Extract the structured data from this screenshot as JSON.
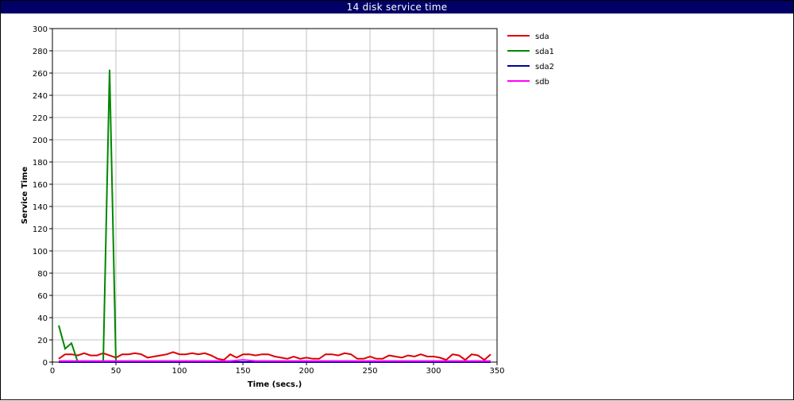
{
  "window": {
    "title": "14 disk service time"
  },
  "chart_data": {
    "type": "line",
    "title": "14 disk service time",
    "xlabel": "Time (secs.)",
    "ylabel": "Service Time",
    "xlim": [
      0,
      350
    ],
    "ylim": [
      0,
      300
    ],
    "xticks": [
      0,
      50,
      100,
      150,
      200,
      250,
      300,
      350
    ],
    "yticks": [
      0,
      20,
      40,
      60,
      80,
      100,
      120,
      140,
      160,
      180,
      200,
      220,
      240,
      260,
      280,
      300
    ],
    "grid": true,
    "legend_position": "right",
    "series": [
      {
        "name": "sda",
        "color": "#dd0000",
        "x": [
          5,
          10,
          15,
          20,
          25,
          30,
          35,
          40,
          45,
          50,
          55,
          60,
          65,
          70,
          75,
          80,
          85,
          90,
          95,
          100,
          105,
          110,
          115,
          120,
          125,
          130,
          135,
          140,
          145,
          150,
          155,
          160,
          165,
          170,
          175,
          180,
          185,
          190,
          195,
          200,
          205,
          210,
          215,
          220,
          225,
          230,
          235,
          240,
          245,
          250,
          255,
          260,
          265,
          270,
          275,
          280,
          285,
          290,
          295,
          300,
          305,
          310,
          315,
          320,
          325,
          330,
          335,
          340,
          345
        ],
        "y": [
          3,
          7,
          7,
          6,
          8,
          6,
          6,
          8,
          6,
          4,
          7,
          7,
          8,
          7,
          4,
          5,
          6,
          7,
          9,
          7,
          7,
          8,
          7,
          8,
          6,
          3,
          2,
          7,
          4,
          7,
          7,
          6,
          7,
          7,
          5,
          4,
          3,
          5,
          3,
          4,
          3,
          3,
          7,
          7,
          6,
          8,
          7,
          3,
          3,
          5,
          3,
          3,
          6,
          5,
          4,
          6,
          5,
          7,
          5,
          5,
          4,
          2,
          7,
          6,
          2,
          7,
          6,
          2,
          7
        ]
      },
      {
        "name": "sda1",
        "color": "#008800",
        "x": [
          5,
          10,
          15,
          20,
          25,
          30,
          35,
          40,
          45,
          50,
          55,
          60
        ],
        "y": [
          33,
          12,
          17,
          0,
          0,
          0,
          0,
          0,
          263,
          0,
          0,
          0
        ]
      },
      {
        "name": "sda2",
        "color": "#000099",
        "x": [
          5,
          50,
          100,
          150,
          200,
          250,
          300,
          345
        ],
        "y": [
          0,
          0,
          0,
          0,
          0,
          0,
          0,
          0
        ]
      },
      {
        "name": "sdb",
        "color": "#ff00ff",
        "x": [
          5,
          20,
          40,
          60,
          80,
          100,
          120,
          140,
          150,
          160,
          180,
          200,
          220,
          240,
          260,
          280,
          300,
          320,
          345
        ],
        "y": [
          1,
          1,
          1,
          1,
          1,
          1,
          1,
          1,
          2,
          1,
          1,
          1,
          1,
          1,
          1,
          1,
          1,
          1,
          1
        ]
      }
    ]
  }
}
